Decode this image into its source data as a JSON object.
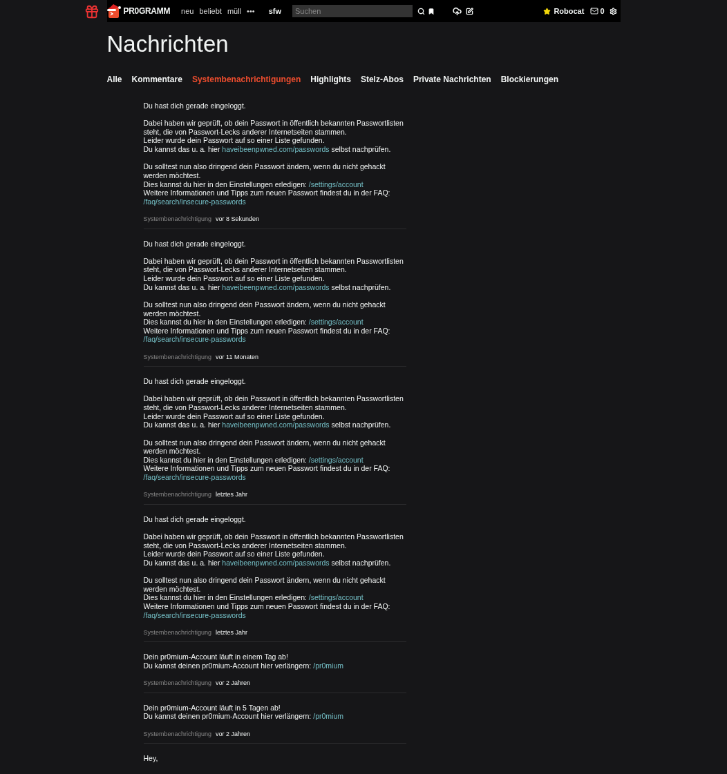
{
  "header": {
    "logo": "PR0GRAMM",
    "nav": [
      {
        "label": "neu"
      },
      {
        "label": "beliebt"
      },
      {
        "label": "müll"
      },
      {
        "label": "•••"
      }
    ],
    "filter": "sfw",
    "search": {
      "placeholder": "Suchen"
    },
    "user": "Robocat",
    "inbox_count": "0"
  },
  "page_title": "Nachrichten",
  "tabs": [
    {
      "label": "Alle",
      "selected": false
    },
    {
      "label": "Kommentare",
      "selected": false
    },
    {
      "label": "Systembenachrichtigungen",
      "selected": true
    },
    {
      "label": "Highlights",
      "selected": false
    },
    {
      "label": "Stelz-Abos",
      "selected": false
    },
    {
      "label": "Private Nachrichten",
      "selected": false
    },
    {
      "label": "Blockierungen",
      "selected": false
    }
  ],
  "messages": [
    {
      "paragraphs": [
        [
          [
            {
              "kind": "text",
              "text": "Du hast dich gerade eingeloggt."
            }
          ]
        ],
        [
          [
            {
              "kind": "text",
              "text": "Dabei haben wir geprüft, ob dein Passwort in öffentlich bekannten Passwortlisten steht, die von Passwort-Lecks anderer Internetseiten stammen."
            }
          ],
          [
            {
              "kind": "text",
              "text": "Leider wurde dein Passwort auf so einer Liste gefunden."
            }
          ],
          [
            {
              "kind": "text",
              "text": "Du kannst das u. a. hier "
            },
            {
              "kind": "link",
              "text": "haveibeenpwned.com/passwords"
            },
            {
              "kind": "text",
              "text": " selbst nachprüfen."
            }
          ]
        ],
        [
          [
            {
              "kind": "text",
              "text": "Du solltest nun also dringend dein Passwort ändern, wenn du nicht gehackt werden möchtest."
            }
          ],
          [
            {
              "kind": "text",
              "text": "Dies kannst du hier in den Einstellungen erledigen: "
            },
            {
              "kind": "link",
              "text": "/settings/account"
            }
          ],
          [
            {
              "kind": "text",
              "text": "Weitere Informationen und Tipps zum neuen Passwort findest du in der FAQ: "
            },
            {
              "kind": "link",
              "text": "/faq/search/insecure-passwords"
            }
          ]
        ]
      ],
      "source": "Systembenachrichtigung",
      "time": "vor 8 Sekunden"
    },
    {
      "paragraphs": [
        [
          [
            {
              "kind": "text",
              "text": "Du hast dich gerade eingeloggt."
            }
          ]
        ],
        [
          [
            {
              "kind": "text",
              "text": "Dabei haben wir geprüft, ob dein Passwort in öffentlich bekannten Passwortlisten steht, die von Passwort-Lecks anderer Internetseiten stammen."
            }
          ],
          [
            {
              "kind": "text",
              "text": "Leider wurde dein Passwort auf so einer Liste gefunden."
            }
          ],
          [
            {
              "kind": "text",
              "text": "Du kannst das u. a. hier "
            },
            {
              "kind": "link",
              "text": "haveibeenpwned.com/passwords"
            },
            {
              "kind": "text",
              "text": " selbst nachprüfen."
            }
          ]
        ],
        [
          [
            {
              "kind": "text",
              "text": "Du solltest nun also dringend dein Passwort ändern, wenn du nicht gehackt werden möchtest."
            }
          ],
          [
            {
              "kind": "text",
              "text": "Dies kannst du hier in den Einstellungen erledigen: "
            },
            {
              "kind": "link",
              "text": "/settings/account"
            }
          ],
          [
            {
              "kind": "text",
              "text": "Weitere Informationen und Tipps zum neuen Passwort findest du in der FAQ: "
            },
            {
              "kind": "link",
              "text": "/faq/search/insecure-passwords"
            }
          ]
        ]
      ],
      "source": "Systembenachrichtigung",
      "time": "vor 11 Monaten"
    },
    {
      "paragraphs": [
        [
          [
            {
              "kind": "text",
              "text": "Du hast dich gerade eingeloggt."
            }
          ]
        ],
        [
          [
            {
              "kind": "text",
              "text": "Dabei haben wir geprüft, ob dein Passwort in öffentlich bekannten Passwortlisten steht, die von Passwort-Lecks anderer Internetseiten stammen."
            }
          ],
          [
            {
              "kind": "text",
              "text": "Leider wurde dein Passwort auf so einer Liste gefunden."
            }
          ],
          [
            {
              "kind": "text",
              "text": "Du kannst das u. a. hier "
            },
            {
              "kind": "link",
              "text": "haveibeenpwned.com/passwords"
            },
            {
              "kind": "text",
              "text": " selbst nachprüfen."
            }
          ]
        ],
        [
          [
            {
              "kind": "text",
              "text": "Du solltest nun also dringend dein Passwort ändern, wenn du nicht gehackt werden möchtest."
            }
          ],
          [
            {
              "kind": "text",
              "text": "Dies kannst du hier in den Einstellungen erledigen: "
            },
            {
              "kind": "link",
              "text": "/settings/account"
            }
          ],
          [
            {
              "kind": "text",
              "text": "Weitere Informationen und Tipps zum neuen Passwort findest du in der FAQ: "
            },
            {
              "kind": "link",
              "text": "/faq/search/insecure-passwords"
            }
          ]
        ]
      ],
      "source": "Systembenachrichtigung",
      "time": "letztes Jahr"
    },
    {
      "paragraphs": [
        [
          [
            {
              "kind": "text",
              "text": "Du hast dich gerade eingeloggt."
            }
          ]
        ],
        [
          [
            {
              "kind": "text",
              "text": "Dabei haben wir geprüft, ob dein Passwort in öffentlich bekannten Passwortlisten steht, die von Passwort-Lecks anderer Internetseiten stammen."
            }
          ],
          [
            {
              "kind": "text",
              "text": "Leider wurde dein Passwort auf so einer Liste gefunden."
            }
          ],
          [
            {
              "kind": "text",
              "text": "Du kannst das u. a. hier "
            },
            {
              "kind": "link",
              "text": "haveibeenpwned.com/passwords"
            },
            {
              "kind": "text",
              "text": " selbst nachprüfen."
            }
          ]
        ],
        [
          [
            {
              "kind": "text",
              "text": "Du solltest nun also dringend dein Passwort ändern, wenn du nicht gehackt werden möchtest."
            }
          ],
          [
            {
              "kind": "text",
              "text": "Dies kannst du hier in den Einstellungen erledigen: "
            },
            {
              "kind": "link",
              "text": "/settings/account"
            }
          ],
          [
            {
              "kind": "text",
              "text": "Weitere Informationen und Tipps zum neuen Passwort findest du in der FAQ: "
            },
            {
              "kind": "link",
              "text": "/faq/search/insecure-passwords"
            }
          ]
        ]
      ],
      "source": "Systembenachrichtigung",
      "time": "letztes Jahr"
    },
    {
      "paragraphs": [
        [
          [
            {
              "kind": "text",
              "text": "Dein pr0mium-Account läuft in einem Tag ab!"
            }
          ],
          [
            {
              "kind": "text",
              "text": "Du kannst deinen pr0mium-Account hier verlängern: "
            },
            {
              "kind": "link",
              "text": "/pr0mium"
            }
          ]
        ]
      ],
      "source": "Systembenachrichtigung",
      "time": "vor 2 Jahren"
    },
    {
      "paragraphs": [
        [
          [
            {
              "kind": "text",
              "text": "Dein pr0mium-Account läuft in 5 Tagen ab!"
            }
          ],
          [
            {
              "kind": "text",
              "text": "Du kannst deinen pr0mium-Account hier verlängern: "
            },
            {
              "kind": "link",
              "text": "/pr0mium"
            }
          ]
        ]
      ],
      "source": "Systembenachrichtigung",
      "time": "vor 2 Jahren"
    },
    {
      "paragraphs": [
        [
          [
            {
              "kind": "text",
              "text": "Hey,"
            }
          ]
        ]
      ]
    }
  ]
}
